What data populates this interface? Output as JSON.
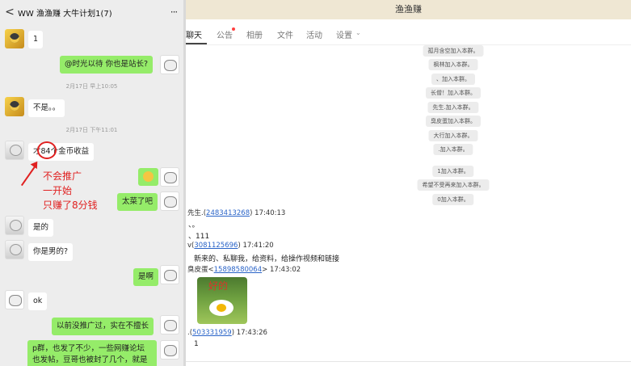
{
  "left": {
    "header": {
      "title": "WW 渔渔赚 大牛计划1(7)",
      "back_icon": "<",
      "more_icon": "···"
    },
    "messages": [
      {
        "side": "in",
        "text": "1"
      },
      {
        "side": "out",
        "text": "@时光以待  你也是站长?"
      },
      {
        "time": "2月17日 早上10:05"
      },
      {
        "side": "in",
        "text": "不是。。"
      },
      {
        "time": "2月17日 下午11:01"
      },
      {
        "side": "in",
        "text_prefix": "才",
        "text_number": "84",
        "text_suffix": "个金币收益"
      },
      {
        "side": "out",
        "emoji": "smile"
      },
      {
        "side": "out",
        "text": "太菜了吧"
      },
      {
        "side": "in",
        "text": "是的"
      },
      {
        "side": "in",
        "text": "你是男的?"
      },
      {
        "side": "out",
        "text": "是啊"
      },
      {
        "side": "in",
        "text": "ok"
      },
      {
        "side": "out",
        "text": "以前没推广过，实在不擅长"
      },
      {
        "side": "out",
        "text": "p群，也发了不少，一些网赚论坛也发帖，豆哥也被封了几个，就是"
      }
    ],
    "annotation": {
      "line1": "不会推广",
      "line2": "一开始",
      "line3": "只赚了8分钱"
    }
  },
  "right": {
    "header_title": "渔渔赚",
    "tabs": [
      "聊天",
      "公告",
      "相册",
      "文件",
      "活动",
      "设置"
    ],
    "system_notices": [
      "孤月含空加入本群。",
      "枫林加入本群。",
      "、加入本群。",
      "长僧！加入本群。",
      "先生.加入本群。",
      "臭皮蛋加入本群。",
      "大行加入本群。",
      ".加入本群。",
      "1加入本群。",
      "希望不受再来加入本群。",
      "0加入本群。"
    ],
    "chats": [
      {
        "name": "先生.",
        "qq": "2483413268",
        "time": "17:40:13",
        "lines": [
          "、。",
          "、111"
        ]
      },
      {
        "name": "v",
        "qq": "3081125696",
        "time": "17:41:20",
        "lines": [
          "新来的、私聊我，给资料，给操作视频和链接"
        ]
      },
      {
        "name": "臭皮蛋<",
        "qq": "15898580064",
        "time": "17:43:02",
        "sticker_text": "好的"
      },
      {
        "name": ".",
        "qq": "503331959",
        "time": "17:43:26",
        "lines": [
          "1"
        ]
      }
    ]
  },
  "colors": {
    "out_bubble": "#95ec69",
    "annotation": "#e02020",
    "right_header_bg": "#efe7d3",
    "link": "#2a64c8"
  }
}
